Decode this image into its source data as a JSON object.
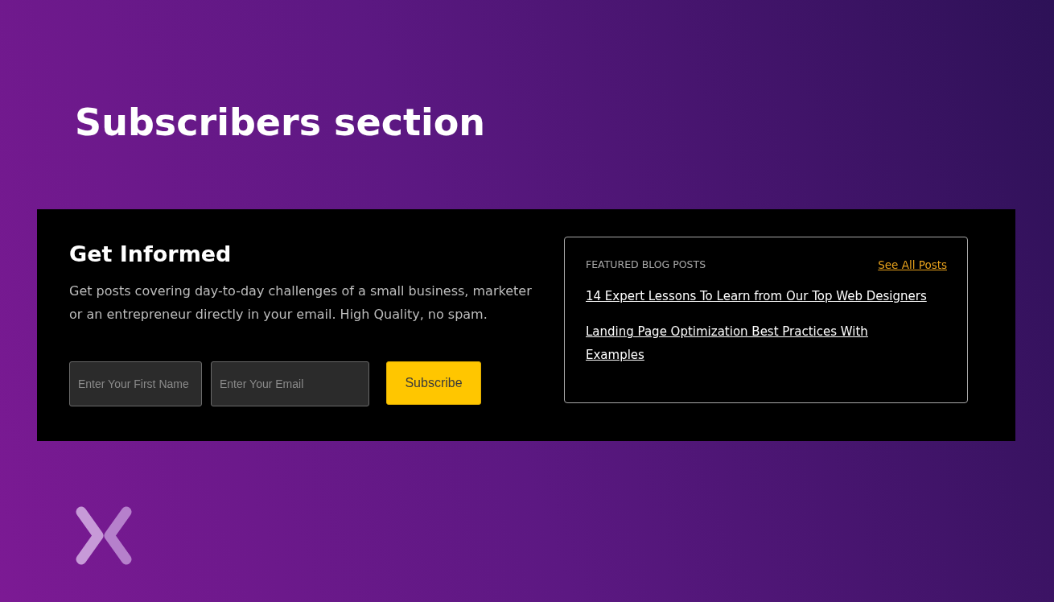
{
  "heading": "Subscribers section",
  "signup": {
    "title": "Get Informed",
    "description": "Get posts covering day-to-day challenges of a small business, marketer or an entrepreneur directly in your email. High Quality, no spam.",
    "fields": [
      {
        "kind": "name",
        "placeholder": "Enter Your First Name"
      },
      {
        "kind": "email",
        "placeholder": "Enter Your Email"
      }
    ],
    "button": "Subscribe"
  },
  "featured": {
    "title": "FEATURED BLOG POSTS",
    "link": "See All Posts",
    "posts": [
      "14 Expert Lessons To Learn from Our Top Web Designers",
      "Landing Page Optimization Best Practices With Examples"
    ]
  }
}
